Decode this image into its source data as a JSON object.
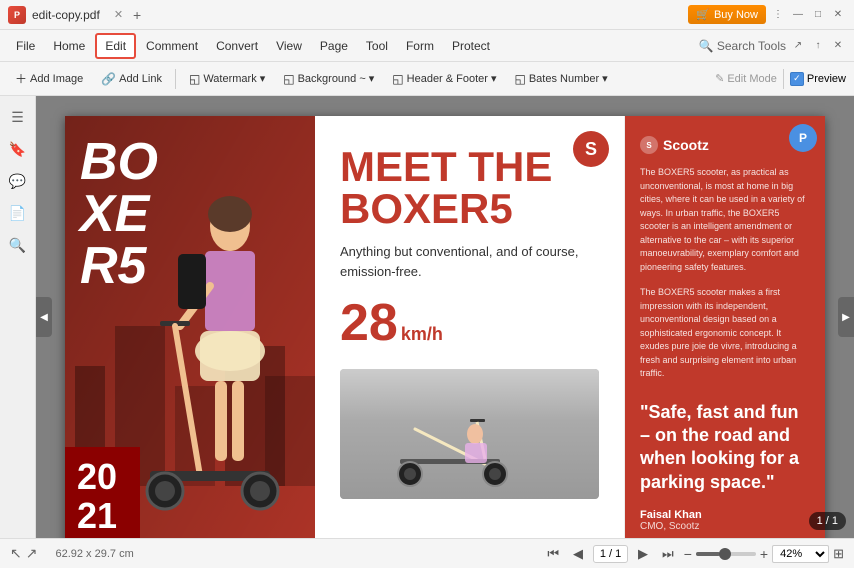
{
  "titleBar": {
    "appIcon": "P",
    "tabTitle": "edit-copy.pdf",
    "buyNow": "Buy Now",
    "windowControls": [
      "—",
      "□",
      "✕"
    ]
  },
  "menuBar": {
    "items": [
      {
        "label": "File",
        "active": false
      },
      {
        "label": "Home",
        "active": false
      },
      {
        "label": "Edit",
        "active": true
      },
      {
        "label": "Comment",
        "active": false
      },
      {
        "label": "Convert",
        "active": false
      },
      {
        "label": "View",
        "active": false
      },
      {
        "label": "Page",
        "active": false
      },
      {
        "label": "Tool",
        "active": false
      },
      {
        "label": "Form",
        "active": false
      },
      {
        "label": "Protect",
        "active": false
      }
    ],
    "searchTools": "Search Tools"
  },
  "toolbar": {
    "buttons": [
      {
        "label": "Add Image",
        "icon": "+"
      },
      {
        "label": "Add Link",
        "icon": "🔗"
      },
      {
        "label": "Watermark",
        "icon": "◱"
      },
      {
        "label": "Background ~",
        "icon": "◱"
      },
      {
        "label": "Header & Footer",
        "icon": "◱"
      },
      {
        "label": "Bates Number",
        "icon": "◱"
      }
    ],
    "editMode": "Edit Mode",
    "preview": "Preview"
  },
  "sidebar": {
    "icons": [
      "☰",
      "🔖",
      "💬",
      "📄",
      "🔍"
    ]
  },
  "pdfContent": {
    "leftSection": {
      "bigText": "BOXE R5",
      "yearText": "20 21"
    },
    "middleSection": {
      "meetThe": "MEET THE",
      "boxer5": "BOXER5",
      "tagline": "Anything but conventional, and of course, emission-free.",
      "speed": "28",
      "speedUnit": "km/h",
      "sCircle": "S"
    },
    "rightSection": {
      "logoText": "Scootz",
      "description1": "The BOXER5 scooter, as practical as unconventional, is most at home in big cities, where it can be used in a variety of ways. In urban traffic, the BOXER5 scooter is an intelligent amendment or alternative to the car – with its superior manoeuvrability, exemplary comfort and pioneering safety features.",
      "description2": "The BOXER5 scooter makes a first impression with its independent, unconventional design based on a sophisticated ergonomic concept. It exudes pure joie de vivre, introducing a fresh and surprising element into urban traffic.",
      "quote": "\"Safe, fast and fun – on the road and when looking for a parking space.\"",
      "authorName": "Faisal Khan",
      "authorTitle": "CMO, Scootz"
    }
  },
  "statusBar": {
    "dimensions": "62.92 x 29.7 cm",
    "pageInput": "1 / 1",
    "pageTotal": "1 / 1",
    "zoom": "42%"
  }
}
